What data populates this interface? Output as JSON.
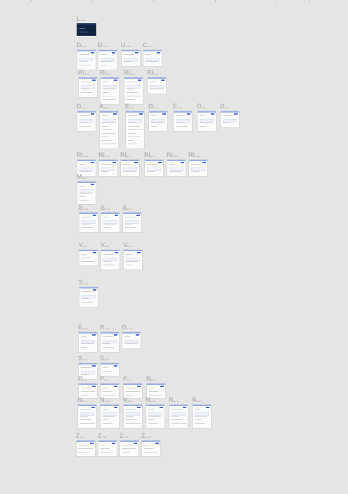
{
  "canvas": {
    "frames": [
      {
        "label": "L...",
        "theme": "dark"
      },
      {
        "label": "D...",
        "theme": "light"
      },
      {
        "label": "D...",
        "theme": "light"
      },
      {
        "label": "U...",
        "theme": "light"
      },
      {
        "label": "C...",
        "theme": "light"
      },
      {
        "label": "Ri...",
        "theme": "light"
      },
      {
        "label": "Ri...",
        "theme": "light"
      },
      {
        "label": "Ri...",
        "theme": "light"
      },
      {
        "label": "Ri...",
        "theme": "light"
      },
      {
        "label": "D...",
        "theme": "light"
      },
      {
        "label": "A...",
        "theme": "light"
      },
      {
        "label": "E...",
        "theme": "light"
      },
      {
        "label": "D...",
        "theme": "light"
      },
      {
        "label": "E...",
        "theme": "light"
      },
      {
        "label": "D...",
        "theme": "light"
      },
      {
        "label": "D...",
        "theme": "light"
      },
      {
        "label": "Ri...",
        "theme": "light"
      },
      {
        "label": "Ri...",
        "theme": "light"
      },
      {
        "label": "Ri...",
        "theme": "light"
      },
      {
        "label": "Ri...",
        "theme": "light"
      },
      {
        "label": "Ri...",
        "theme": "light"
      },
      {
        "label": "Ri...",
        "theme": "light"
      },
      {
        "label": "M...",
        "theme": "light"
      },
      {
        "label": "S...",
        "theme": "light"
      },
      {
        "label": "S...",
        "theme": "light"
      },
      {
        "label": "S...",
        "theme": "light"
      },
      {
        "label": "V...",
        "theme": "light"
      },
      {
        "label": "V...",
        "theme": "light"
      },
      {
        "label": "V...",
        "theme": "light"
      },
      {
        "label": "S...",
        "theme": "light"
      },
      {
        "label": "E...",
        "theme": "light"
      },
      {
        "label": "R...",
        "theme": "light"
      },
      {
        "label": "G...",
        "theme": "light"
      },
      {
        "label": "S...",
        "theme": "light"
      },
      {
        "label": "S...",
        "theme": "light"
      },
      {
        "label": "P...",
        "theme": "light"
      },
      {
        "label": "P...",
        "theme": "light"
      },
      {
        "label": "P...",
        "theme": "light"
      },
      {
        "label": "R...",
        "theme": "light"
      },
      {
        "label": "N...",
        "theme": "light"
      },
      {
        "label": "N...",
        "theme": "light"
      },
      {
        "label": "N...",
        "theme": "light"
      },
      {
        "label": "N...",
        "theme": "light"
      },
      {
        "label": "N...",
        "theme": "light"
      },
      {
        "label": "N...",
        "theme": "light"
      },
      {
        "label": "Z...",
        "theme": "light"
      },
      {
        "label": "Z...",
        "theme": "light"
      },
      {
        "label": "Z...",
        "theme": "light"
      },
      {
        "label": "Z...",
        "theme": "light"
      }
    ]
  },
  "colors": {
    "background": "#e5e5e5",
    "label": "#b3b3b3",
    "accent": "#4a6fd8"
  }
}
